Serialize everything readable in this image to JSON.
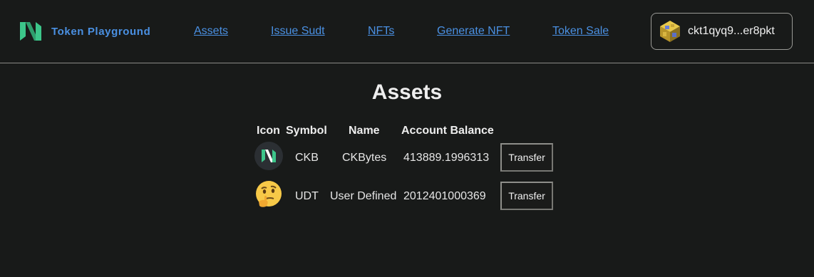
{
  "header": {
    "brand": "Token Playground",
    "brand_icon": "nervos-logo-icon",
    "nav": [
      "Assets",
      "Issue Sudt",
      "NFTs",
      "Generate NFT",
      "Token Sale"
    ],
    "wallet_address": "ckt1qyq9...er8pkt",
    "wallet_icon": "identicon-avatar-icon"
  },
  "main": {
    "title": "Assets",
    "columns": [
      "Icon",
      "Symbol",
      "Name",
      "Account Balance"
    ],
    "rows": [
      {
        "icon": "ckb-logo-icon",
        "symbol": "CKB",
        "name": "CKBytes",
        "balance": "413889.1996313",
        "action": "Transfer"
      },
      {
        "icon": "thinking-face-icon",
        "symbol": "UDT",
        "name": "User Defined",
        "balance": "2012401000369",
        "action": "Transfer"
      }
    ]
  },
  "colors": {
    "background": "#181a19",
    "link": "#4a90e2",
    "logo_green": "#3cc68a"
  }
}
